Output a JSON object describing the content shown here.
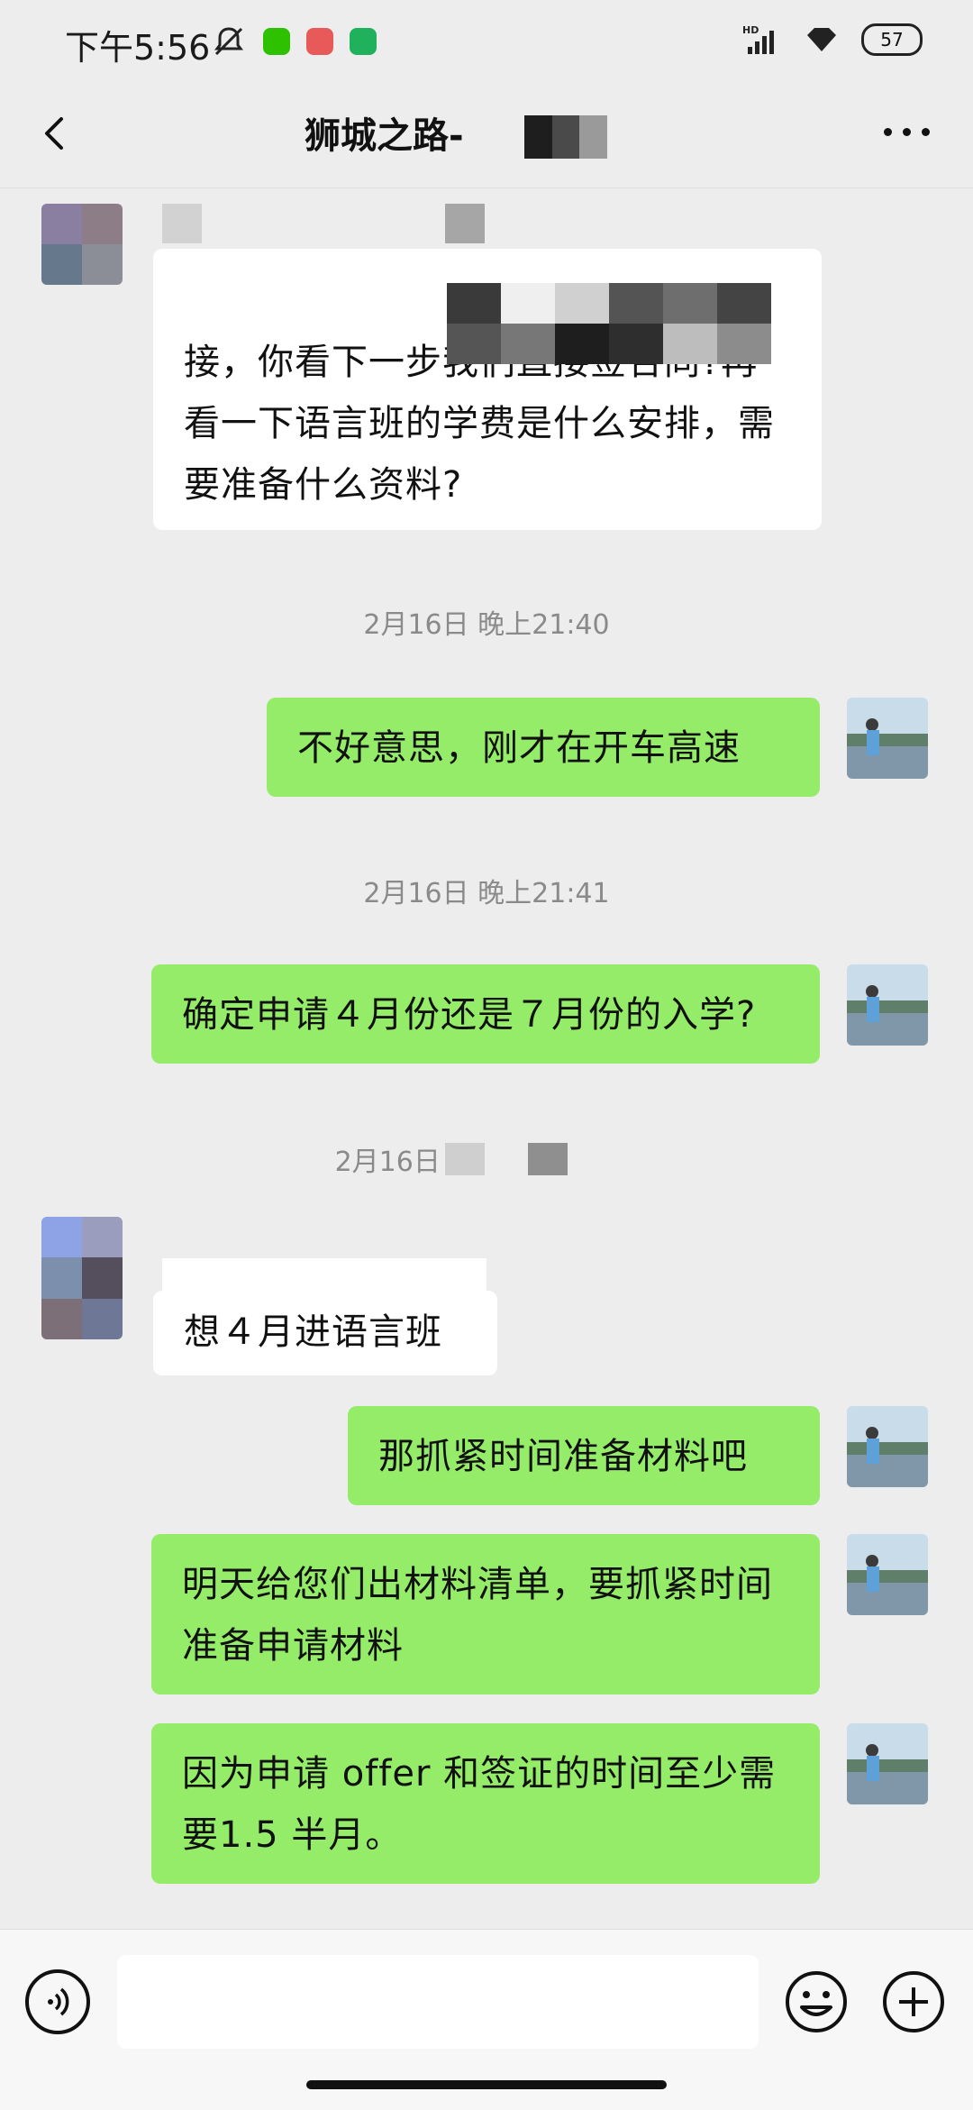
{
  "status_bar": {
    "time": "下午5:56",
    "battery": "57",
    "app_icons": [
      "wechat-icon",
      "mail-icon",
      "phone-icon"
    ],
    "network_label": "HD"
  },
  "header": {
    "title": "狮城之路-"
  },
  "messages": {
    "m1": {
      "sender": "other",
      "text": "接，你看下一步我们直接签合同?再看一下语言班的学费是什么安排，需要准备什么资料?"
    },
    "ts1": "2月16日 晚上21:40",
    "m2": {
      "sender": "me",
      "text": "不好意思，刚才在开车高速"
    },
    "ts2": "2月16日 晚上21:41",
    "m3": {
      "sender": "me",
      "text": "确定申请４月份还是７月份的入学?"
    },
    "ts3": "2月16日 晚",
    "m4": {
      "sender": "other",
      "text": "想４月进语言班"
    },
    "m5": {
      "sender": "me",
      "text": "那抓紧时间准备材料吧"
    },
    "m6": {
      "sender": "me",
      "text": "明天给您们出材料清单，要抓紧时间准备申请材料"
    },
    "m7": {
      "sender": "me",
      "text": "因为申请 offer 和签证的时间至少需要1.5 半月。"
    }
  },
  "input": {
    "placeholder": ""
  },
  "colors": {
    "outgoing_bubble": "#95ec69",
    "incoming_bubble": "#ffffff",
    "background": "#ededed"
  }
}
